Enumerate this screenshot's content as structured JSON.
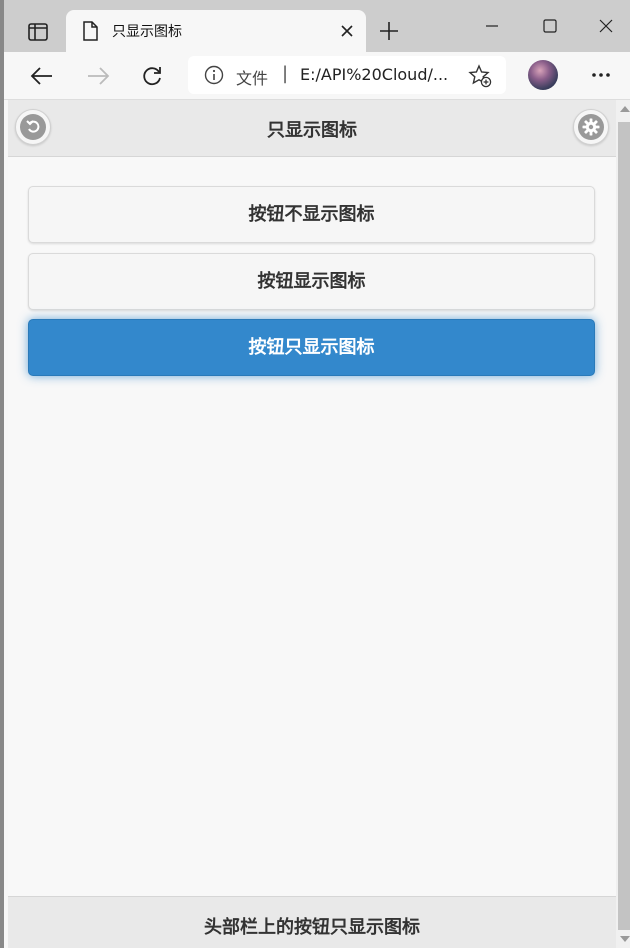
{
  "browser": {
    "tab_title": "只显示图标",
    "address": {
      "file_label": "文件",
      "separator": "|",
      "url": "E:/API%20Cloud/..."
    }
  },
  "page": {
    "header": {
      "title": "只显示图标",
      "back_icon": "back-arrow-icon",
      "settings_icon": "gear-icon"
    },
    "buttons": [
      {
        "label": "按钮不显示图标",
        "active": false
      },
      {
        "label": "按钮显示图标",
        "active": false
      },
      {
        "label": "按钮只显示图标",
        "active": true
      }
    ],
    "footer": {
      "text": "头部栏上的按钮只显示图标"
    }
  },
  "colors": {
    "accent": "#3388cc",
    "header_bg": "#e9e9e9",
    "page_bg": "#f8f8f8"
  }
}
